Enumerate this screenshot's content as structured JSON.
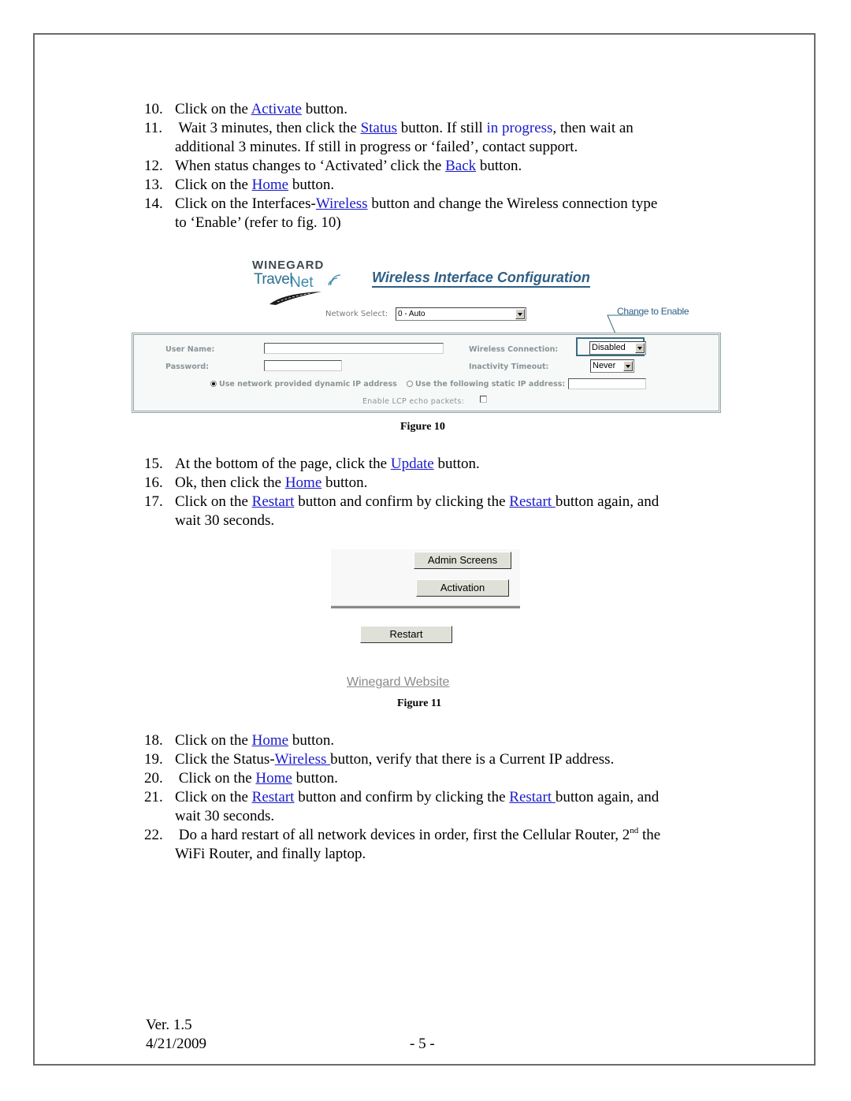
{
  "steps_top": [
    {
      "num": "10.",
      "parts": [
        "Click on the ",
        {
          "link": "Activate"
        },
        " button."
      ]
    },
    {
      "num": "11.",
      "parts": [
        " Wait 3 minutes, then click the ",
        {
          "link": "Status"
        },
        " button.   If still ",
        {
          "blue": "in progress"
        },
        ", then wait an"
      ],
      "cont": "additional 3 minutes.  If still in progress or ‘failed’, contact support."
    },
    {
      "num": "12.",
      "parts": [
        "When status changes to ‘Activated’ click the ",
        {
          "link": "Back"
        },
        " button."
      ]
    },
    {
      "num": "13.",
      "parts": [
        "Click on the ",
        {
          "link": "Home"
        },
        " button."
      ]
    },
    {
      "num": "14.",
      "parts": [
        "Click on the Interfaces-",
        {
          "link": "Wireless"
        },
        " button and  change the Wireless connection type"
      ],
      "cont": "to ‘Enable’ (refer to fig. 10)"
    }
  ],
  "figure10": {
    "logo_brand": "WINEGARD",
    "logo_travel": "Travel",
    "logo_net": "Net",
    "title": "Wireless Interface Configuration",
    "network_select_label": "Network Select:",
    "network_select_value": "0 - Auto",
    "callout": "Change to Enable",
    "user_name_label": "User Name:",
    "user_name_value": "",
    "password_label": "Password:",
    "password_value": "",
    "wireless_connection_label": "Wireless Connection:",
    "wireless_connection_value": "Disabled",
    "inactivity_timeout_label": "Inactivity Timeout:",
    "inactivity_timeout_value": "Never",
    "radio_dynamic_label": "Use network provided dynamic IP address",
    "radio_static_label": "Use the following static IP address:",
    "static_ip_value": "",
    "lcp_label": "Enable LCP echo packets:",
    "caption": "Figure 10"
  },
  "steps_mid": [
    {
      "num": "15.",
      "parts": [
        "At the bottom of the page, click the ",
        {
          "link": "Update"
        },
        " button."
      ]
    },
    {
      "num": "16.",
      "parts": [
        "Ok, then click the ",
        {
          "link": "Home"
        },
        " button."
      ]
    },
    {
      "num": "17.",
      "parts": [
        "Click on the ",
        {
          "link": "Restart"
        },
        " button and confirm by clicking the ",
        {
          "link": "Restart "
        },
        "button again, and"
      ],
      "cont": "wait 30 seconds."
    }
  ],
  "figure11": {
    "admin_screens_button": "Admin Screens",
    "activation_button": "Activation",
    "restart_button": "Restart",
    "website_link": "Winegard Website",
    "caption": "Figure 11"
  },
  "steps_bottom": [
    {
      "num": "18.",
      "parts": [
        "Click on the ",
        {
          "link": "Home"
        },
        " button."
      ]
    },
    {
      "num": "19.",
      "parts": [
        "Click the Status-",
        {
          "link": "Wireless "
        },
        "button, verify that there is a Current IP address."
      ]
    },
    {
      "num": "20.",
      "parts": [
        " Click on the ",
        {
          "link": "Home"
        },
        " button."
      ]
    },
    {
      "num": "21.",
      "parts": [
        "Click on the ",
        {
          "link": "Restart"
        },
        " button and confirm by clicking the ",
        {
          "link": "Restart "
        },
        "button again, and"
      ],
      "cont": "wait 30 seconds."
    },
    {
      "num": "22.",
      "parts": [
        " Do a hard restart of all network devices in order, first the Cellular Router, 2",
        {
          "sup": "nd"
        },
        " the"
      ],
      "cont": "WiFi Router, and finally laptop."
    }
  ],
  "footer": {
    "version": "Ver. 1.5",
    "date": "4/21/2009",
    "page_number": "- 5 -"
  }
}
